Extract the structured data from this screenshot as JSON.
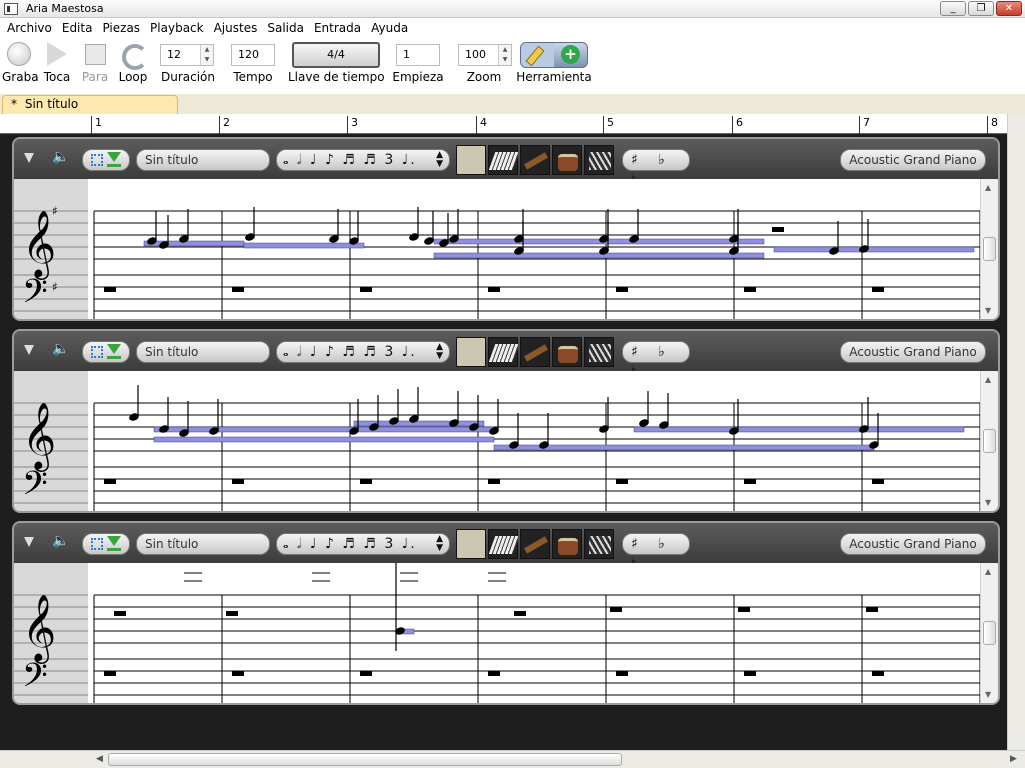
{
  "window": {
    "title": "Aria Maestosa",
    "minimize": "_",
    "restore": "❐",
    "close": "✕"
  },
  "menu": [
    "Archivo",
    "Edita",
    "Piezas",
    "Playback",
    "Ajustes",
    "Salida",
    "Entrada",
    "Ayuda"
  ],
  "toolbar": {
    "record": "Graba",
    "play": "Toca",
    "stop": "Para",
    "loop": "Loop",
    "duration": {
      "label": "Duración",
      "value": "12"
    },
    "tempo": {
      "label": "Tempo",
      "value": "120"
    },
    "time_sig": {
      "label": "Llave de tiempo",
      "value": "4/4"
    },
    "start": {
      "label": "Empieza",
      "value": "1"
    },
    "zoom": {
      "label": "Zoom",
      "value": "100"
    },
    "tool": {
      "label": "Herramienta"
    }
  },
  "tab": {
    "marker": "*",
    "title": "Sin título"
  },
  "ruler": [
    "1",
    "2",
    "3",
    "4",
    "5",
    "6",
    "7",
    "8"
  ],
  "tracks": [
    {
      "name": "Sin título",
      "instrument": "Acoustic Grand Piano",
      "key_sharp": true
    },
    {
      "name": "Sin título",
      "instrument": "Acoustic Grand Piano",
      "key_sharp": false
    },
    {
      "name": "Sin título",
      "instrument": "Acoustic Grand Piano",
      "key_sharp": false
    }
  ],
  "track_controls": {
    "durations": "𝅝 𝅗𝅥 ♩ ♪ ♬ ♬  3 ♩.",
    "accidentals": "♯ ♭ ♮"
  },
  "icons": {
    "speaker": "speaker-icon",
    "collapse": "collapse-triangle-icon"
  }
}
